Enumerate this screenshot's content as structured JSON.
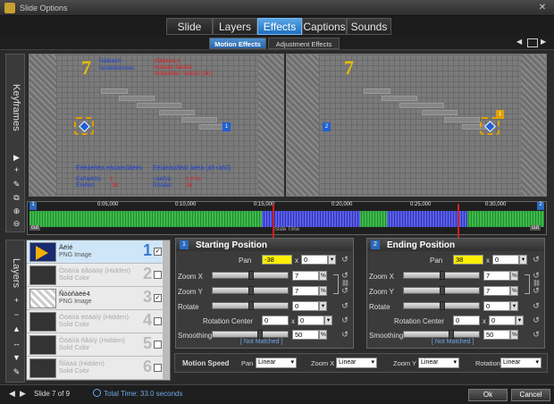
{
  "window": {
    "title": "Slide Options"
  },
  "tabs": [
    "Slide",
    "Layers",
    "Effects",
    "Captions",
    "Sounds"
  ],
  "active_tab": "Effects",
  "subtabs": [
    "Motion Effects",
    "Adjustment Effects"
  ],
  "keyframes_label": "Keyframes",
  "layers_label": "Layers",
  "preview": {
    "left_digit": "7",
    "right_digit": "7",
    "left_overlay_blue_1": "Ñöåìàíöì",
    "left_overlay_blue_2": "Ïàòëèåíéèòëü",
    "left_overlay_red_1": "Ôåèëàà è",
    "left_overlay_red_2": "ìéäìáäíì Ïàéãíä",
    "left_overlay_red_3": "ìéäìäáðàò 'ìéäìáò' (åìì)",
    "left_bottom_blue_1": "Ëëèàèñëà ëàüàèüîàëèò",
    "left_bottom_blue_2": "Ëëìàèàüðëàî åéëà (áñ+àñíî)",
    "left_bottom_kv": [
      "Ëèñàðíñò",
      "1",
      "Ëìòñèô",
      "-38",
      "+àèñíà",
      "0.0 %",
      "Ñîìäåèï",
      "38"
    ],
    "left_marker": "1",
    "right_marker_a": "2",
    "right_marker_b": "1"
  },
  "timeline": {
    "ticks": [
      "0:05,000",
      "0:10,000",
      "0:15,000",
      "0:20,000",
      "0:25,000",
      "0:30,000"
    ],
    "left_num": "1",
    "right_num": "2",
    "cut_left": "cut",
    "cut_right": "cut",
    "slide_time_label": "Slide Time"
  },
  "layers": [
    {
      "name": "Äëíé",
      "sub": "PNG Image",
      "num": "1",
      "checked": true,
      "selected": true,
      "dim": false
    },
    {
      "name": "Ööäìíà äåöàäÿ (Hidden)",
      "sub": "Solid Color",
      "num": "2",
      "checked": false,
      "selected": false,
      "dim": true
    },
    {
      "name": "Ñòòñàëè4",
      "sub": "PNG Image",
      "num": "3",
      "checked": true,
      "selected": false,
      "dim": false
    },
    {
      "name": "Ööäìíà ëöäàìÿ (Hidden)",
      "sub": "Solid Color",
      "num": "4",
      "checked": false,
      "selected": false,
      "dim": true
    },
    {
      "name": "Ööäìíà ñåàìÿ (Hidden)",
      "sub": "Solid Color",
      "num": "5",
      "checked": false,
      "selected": false,
      "dim": true
    },
    {
      "name": "Ñîàäà (Hidden)",
      "sub": "Solid Color",
      "num": "6",
      "checked": false,
      "selected": false,
      "dim": true
    }
  ],
  "start": {
    "num": "1",
    "title": "Starting Position",
    "pan_label": "Pan",
    "pan_x": "-38",
    "pan_y": "0",
    "zoomx_label": "Zoom X",
    "zoomx": "7",
    "zoomy_label": "Zoom Y",
    "zoomy": "7",
    "rotate_label": "Rotate",
    "rotate": "0",
    "rc_label": "Rotation Center",
    "rc_x": "0",
    "rc_y": "0",
    "smooth_label": "Smoothing",
    "smooth": "50",
    "not_matched": "[ Not Matched ]",
    "x": "x",
    "pct": "%"
  },
  "end": {
    "num": "2",
    "title": "Ending Position",
    "pan_label": "Pan",
    "pan_x": "38",
    "pan_y": "0",
    "zoomx_label": "Zoom X",
    "zoomx": "7",
    "zoomy_label": "Zoom Y",
    "zoomy": "7",
    "rotate_label": "Rotate",
    "rotate": "0",
    "rc_label": "Rotation Center",
    "rc_x": "0",
    "rc_y": "0",
    "smooth_label": "Smoothing",
    "smooth": "50",
    "not_matched": "[ Not Matched ]",
    "x": "x",
    "pct": "%"
  },
  "speed": {
    "title": "Motion Speed",
    "pan_label": "Pan",
    "pan_value": "Linear",
    "zoomx_label": "Zoom X",
    "zoomx_value": "Linear",
    "zoomy_label": "Zoom Y",
    "zoomy_value": "Linear",
    "rotation_label": "Rotation",
    "rotation_value": "Linear"
  },
  "footer": {
    "slide_label": "Slide 7 of 9",
    "total_time": "Total Time: 33.0 seconds",
    "ok": "Ok",
    "cancel": "Cancel"
  },
  "colors": {
    "accent": "#2a7ad0",
    "highlight": "#fff000",
    "arrow": "#d02020"
  }
}
